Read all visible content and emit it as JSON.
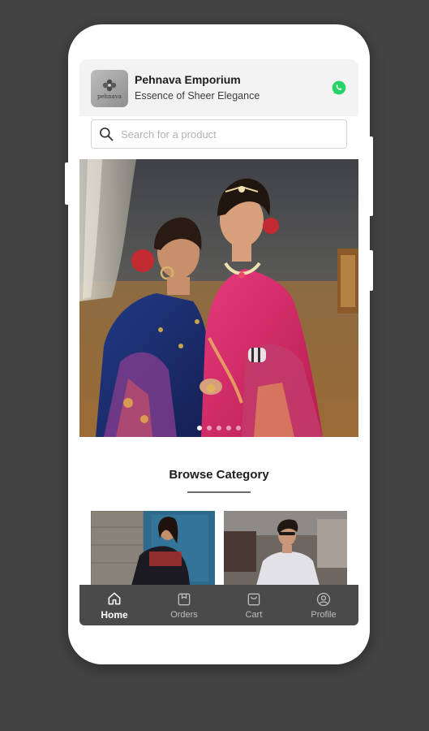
{
  "store": {
    "name": "Pehnava Emporium",
    "tagline": "Essence of Sheer Elegance",
    "logo_text": "pehnava"
  },
  "search": {
    "placeholder": "Search for a product"
  },
  "banner": {
    "slide_count": 5,
    "active_slide": 1
  },
  "browse": {
    "title": "Browse Category"
  },
  "nav": {
    "items": [
      {
        "label": "Home",
        "icon": "home-icon",
        "active": true
      },
      {
        "label": "Orders",
        "icon": "orders-icon",
        "active": false
      },
      {
        "label": "Cart",
        "icon": "cart-icon",
        "active": false
      },
      {
        "label": "Profile",
        "icon": "profile-icon",
        "active": false
      }
    ]
  },
  "colors": {
    "background": "#434343",
    "nav_bar": "#4a4a4a",
    "whatsapp": "#25D366",
    "header_bg": "#f3f3f3"
  }
}
